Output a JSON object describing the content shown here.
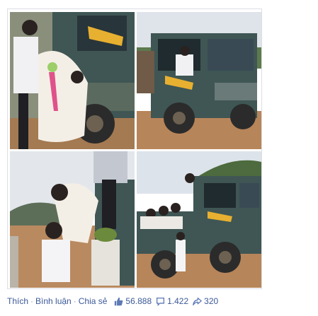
{
  "post": {
    "actions": {
      "like_label": "Thích",
      "comment_label": "Bình luận",
      "share_label": "Chia sẻ",
      "separator": "·"
    },
    "stats": {
      "likes": "56.888",
      "comments": "1.422",
      "shares": "320"
    },
    "icons": {
      "like": "thumbs-up-icon",
      "comment": "speech-bubble-icon",
      "share": "share-arrow-icon"
    }
  },
  "colors": {
    "link": "#3b5998",
    "text": "#4e5665",
    "truck": "#3f5654",
    "mud": "#b7855a"
  }
}
